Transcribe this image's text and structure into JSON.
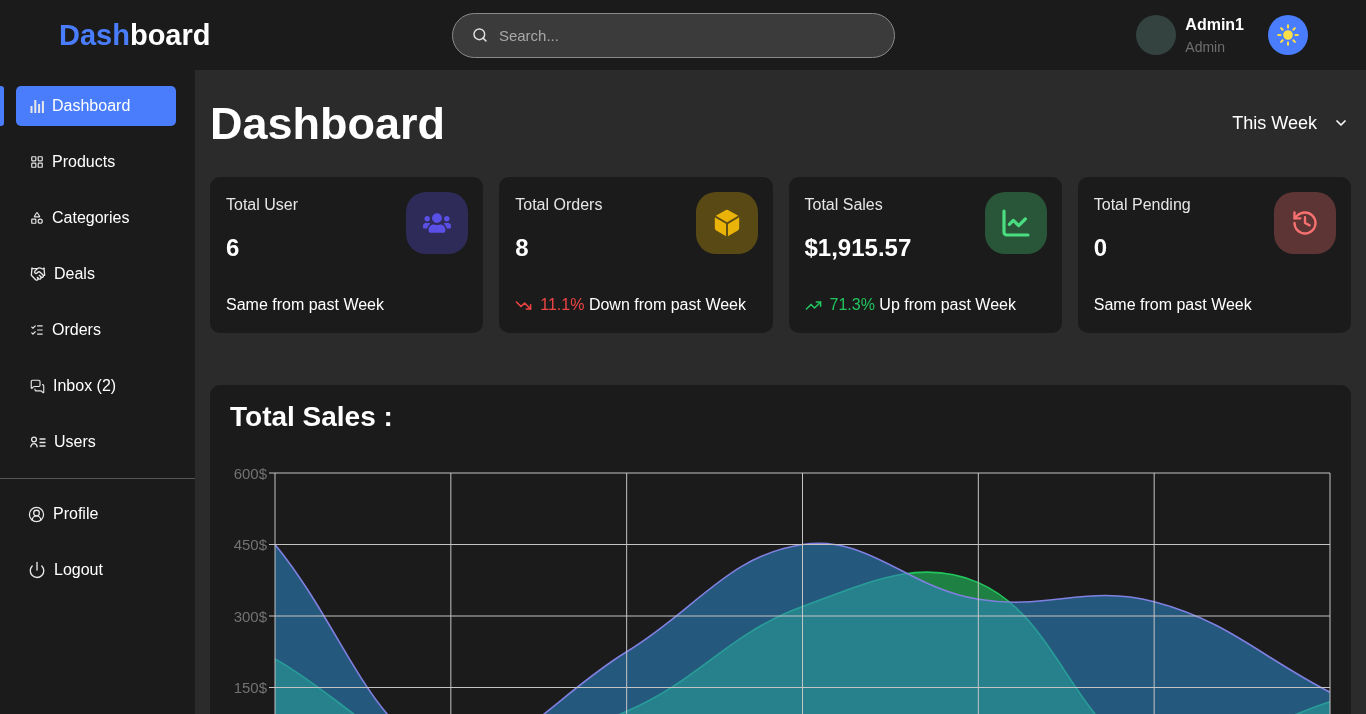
{
  "header": {
    "logo": {
      "accent": "Dash",
      "rest": "board"
    },
    "search": {
      "placeholder": "Search..."
    },
    "user": {
      "name": "Admin1",
      "role": "Admin"
    }
  },
  "sidebar": {
    "items": [
      {
        "label": "Dashboard",
        "selected": true
      },
      {
        "label": "Products",
        "selected": false
      },
      {
        "label": "Categories",
        "selected": false
      },
      {
        "label": "Deals",
        "selected": false
      },
      {
        "label": "Orders",
        "selected": false
      },
      {
        "label": "Inbox (2)",
        "selected": false
      },
      {
        "label": "Users",
        "selected": false
      }
    ],
    "bottom_items": [
      {
        "label": "Profile",
        "selected": false
      },
      {
        "label": "Logout",
        "selected": false
      }
    ]
  },
  "main": {
    "title": "Dashboard",
    "period": "This Week",
    "stats": [
      {
        "title": "Total User",
        "value": "6",
        "color": "#5b50e6",
        "kind": "same",
        "note": "Same from past Week"
      },
      {
        "title": "Total Orders",
        "value": "8",
        "color": "#eab308",
        "kind": "down",
        "change": "11.1%",
        "note": "Down from past Week"
      },
      {
        "title": "Total Sales",
        "value": "$1,915.57",
        "color": "#4ade80",
        "kind": "up",
        "change": "71.3%",
        "note": "Up from past Week"
      },
      {
        "title": "Total Pending",
        "value": "0",
        "color": "#f87171",
        "kind": "same",
        "note": "Same from past Week"
      }
    ],
    "sales_chart": {
      "title": "Total Sales :",
      "chart_data": {
        "type": "area",
        "grid": true,
        "ylim": [
          0,
          600
        ],
        "yticks": [
          {
            "value": 150,
            "label": "150$"
          },
          {
            "value": 300,
            "label": "300$"
          },
          {
            "value": 450,
            "label": "450$"
          },
          {
            "value": 600,
            "label": "600$"
          }
        ],
        "series": [
          {
            "color": "#2d82c0",
            "values": [
              450,
              0,
              225,
              450,
              335,
              330,
              140
            ]
          },
          {
            "color": "#22c55e",
            "values": [
              210,
              0,
              100,
              320,
              370,
              0,
              120
            ]
          }
        ]
      }
    }
  }
}
